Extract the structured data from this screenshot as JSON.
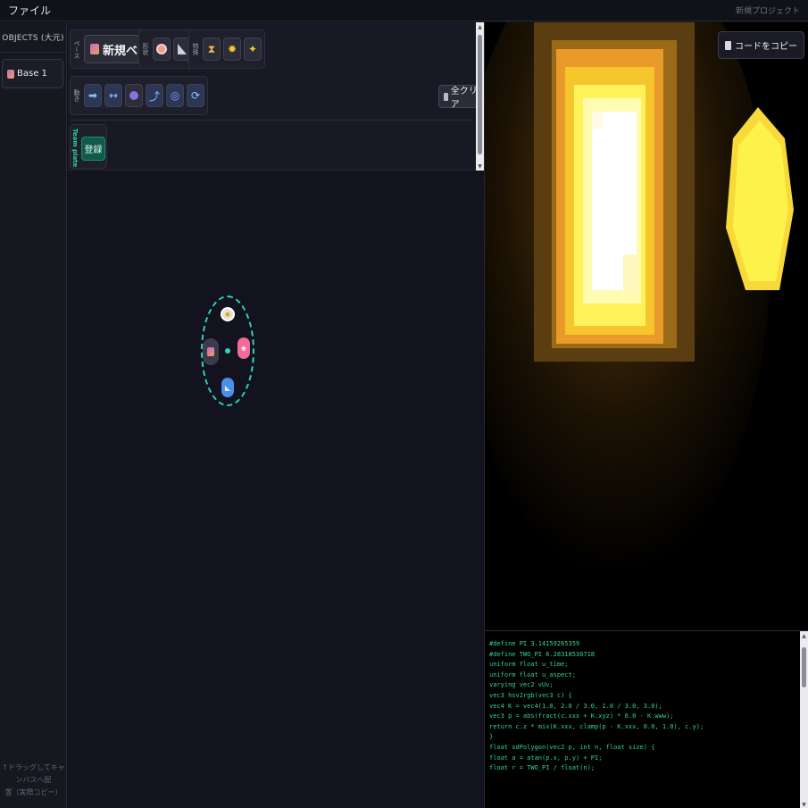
{
  "menubar": {
    "file_label": "ファイル",
    "project_label": "新規プロジェクト"
  },
  "sidebar": {
    "title": "OBJECTS (大元)",
    "items": [
      {
        "label": "Base 1"
      }
    ],
    "hint_line1": "↑ドラッグしてキャンバスへ配",
    "hint_line2": "置（実際コピー）"
  },
  "toolbar": {
    "base_group_label": "ベース",
    "new_base_label": "新規ベース",
    "shape_group_label": "形状",
    "effect_group_label": "特殊",
    "motion_group_label": "動き",
    "clear_label": "全クリア",
    "team_label": "Team plate",
    "register_label": "登録"
  },
  "preview": {
    "copy_label": "コードをコピー"
  },
  "code": {
    "lines": [
      "#define PI 3.14159265359",
      "#define TWO_PI 6.28318530718",
      "",
      "uniform float u_time;",
      "uniform float u_aspect;",
      "varying vec2 vUv;",
      "",
      "vec3 hsv2rgb(vec3 c) {",
      "vec4 K = vec4(1.0, 2.0 / 3.0, 1.0 / 3.0, 3.0);",
      "vec3 p = abs(fract(c.xxx + K.xyz) * 6.0 - K.www);",
      "return c.z * mix(K.xxx, clamp(p - K.xxx, 0.0, 1.0), c.y);",
      "}",
      "",
      "float sdPolygon(vec2 p, int n, float size) {",
      "float a = atan(p.x, p.y) + PI;",
      "float r = TWO_PI / float(n);"
    ]
  },
  "colors": {
    "accent": "#2dd4bf",
    "team": "#2dd4a0",
    "bg": "#10121b"
  }
}
